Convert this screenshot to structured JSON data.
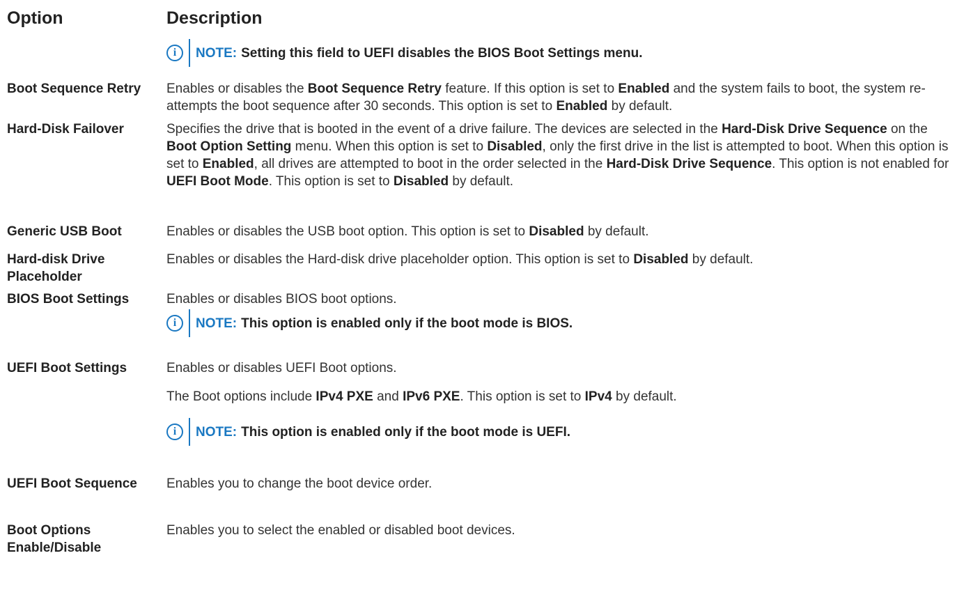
{
  "header": {
    "option": "Option",
    "description": "Description"
  },
  "top_note": {
    "label": "NOTE:",
    "text": "Setting this field to UEFI disables the BIOS Boot Settings menu."
  },
  "rows": [
    {
      "option": "Boot Sequence Retry",
      "description": [
        {
          "t": "Enables or disables the "
        },
        {
          "t": "Boot Sequence Retry",
          "b": true
        },
        {
          "t": " feature. If this option is set to "
        },
        {
          "t": "Enabled",
          "b": true
        },
        {
          "t": " and the system fails to boot, the system re-attempts the boot sequence after 30 seconds. This option is set to "
        },
        {
          "t": "Enabled",
          "b": true
        },
        {
          "t": " by default."
        }
      ]
    },
    {
      "option": "Hard-Disk Failover",
      "description": [
        {
          "t": "Specifies the drive that is booted in the event of a drive failure. The devices are selected in the "
        },
        {
          "t": "Hard-Disk Drive Sequence",
          "b": true
        },
        {
          "t": " on the "
        },
        {
          "t": "Boot Option Setting",
          "b": true
        },
        {
          "t": " menu. When this option is set to "
        },
        {
          "t": "Disabled",
          "b": true
        },
        {
          "t": ", only the first drive in the list is attempted to boot. When this option is set to "
        },
        {
          "t": "Enabled",
          "b": true
        },
        {
          "t": ", all drives are attempted to boot in the order selected in the "
        },
        {
          "t": "Hard-Disk Drive Sequence",
          "b": true
        },
        {
          "t": ". This option is not enabled for "
        },
        {
          "t": "UEFI Boot Mode",
          "b": true
        },
        {
          "t": ". This option is set to "
        },
        {
          "t": "Disabled",
          "b": true
        },
        {
          "t": " by default."
        }
      ]
    },
    {
      "option": "Generic USB Boot",
      "description": [
        {
          "t": "Enables or disables the USB boot option. This option is set to "
        },
        {
          "t": "Disabled",
          "b": true
        },
        {
          "t": " by default."
        }
      ]
    },
    {
      "option": "Hard-disk Drive Placeholder",
      "description": [
        {
          "t": "Enables or disables the Hard-disk drive placeholder option. This option is set to "
        },
        {
          "t": "Disabled",
          "b": true
        },
        {
          "t": " by default."
        }
      ]
    },
    {
      "option": "BIOS Boot Settings",
      "description": [
        {
          "t": "Enables or disables BIOS boot options."
        }
      ],
      "note": {
        "label": "NOTE:",
        "text": "This option is enabled only if the boot mode is BIOS."
      }
    },
    {
      "option": "UEFI Boot Settings",
      "description": [
        {
          "t": "Enables or disables UEFI Boot options."
        }
      ],
      "description2": [
        {
          "t": "The Boot options include "
        },
        {
          "t": "IPv4 PXE",
          "b": true
        },
        {
          "t": " and "
        },
        {
          "t": "IPv6 PXE",
          "b": true
        },
        {
          "t": ". This option is set to "
        },
        {
          "t": "IPv4",
          "b": true
        },
        {
          "t": " by default."
        }
      ],
      "note": {
        "label": "NOTE:",
        "text": "This option is enabled only if the boot mode is UEFI."
      }
    },
    {
      "option": "UEFI Boot Sequence",
      "description": [
        {
          "t": "Enables you to change the boot device order."
        }
      ]
    },
    {
      "option": "Boot Options Enable/Disable",
      "description": [
        {
          "t": "Enables you to select the enabled or disabled boot devices."
        }
      ]
    }
  ],
  "icons": {
    "note_icon": "info-circle-icon",
    "accent_color": "#1a78c2"
  }
}
